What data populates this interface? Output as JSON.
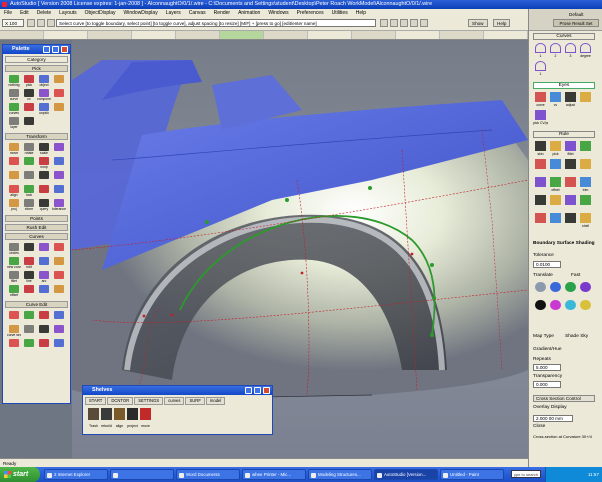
{
  "window": {
    "title": "AutoStudio [ Version 2008 License expires: 1-jan-2008 ] - AlconnaughtO/0/1/.wire - C:\\Documents and Settings\\student\\Desktop\\Peter Roach WorkModel\\AlconnaughtO/0/1/.wire"
  },
  "menu": [
    "File",
    "Edit",
    "Delete",
    "Layouts",
    "ObjectDisplay",
    "WindowDisplay",
    "Layers",
    "Canvas",
    "Render",
    "Animation",
    "Windows",
    "Preferences",
    "Utilities",
    "Help"
  ],
  "toolbar": {
    "zoom": "X 100",
    "hint": "Select curve [to toggle boundary, select point] [to toggle curve], adjust spacing [to resize] [M/F] + [press to go] [edit/enter name]",
    "btn_a": "Show",
    "btn_b": "Help"
  },
  "section_bar": [
    "",
    "",
    "",
    "",
    "",
    "",
    "",
    "",
    "",
    "",
    "",
    ""
  ],
  "palette": {
    "title": "Palette",
    "category": "Category",
    "sections": [
      {
        "label": "Pick",
        "items": [
          "nothing",
          "pick",
          "object",
          "",
          "curve",
          "cv",
          "component",
          "",
          "curves",
          "",
          "unpick",
          "",
          "layer",
          ""
        ]
      },
      {
        "label": "Transform",
        "items": [
          "move",
          "rotate",
          "scale",
          "",
          "",
          "",
          "nonp",
          "",
          "",
          "",
          "",
          "",
          "align",
          "lock",
          "",
          "",
          "proj",
          "xform",
          "query",
          "tolerance"
        ]
      },
      {
        "label": "Points",
        "items": []
      },
      {
        "label": "Rush Edit",
        "items": []
      },
      {
        "label": "Curves",
        "items": [
          "circles",
          "",
          "",
          "",
          "new curve",
          "edit",
          "",
          "",
          "fillet",
          "line",
          "arc",
          "",
          "offset",
          "",
          "",
          ""
        ]
      },
      {
        "label": "Curve Edit",
        "items": [
          "",
          "",
          "",
          "",
          "curve section",
          "",
          "",
          "",
          "",
          "",
          "",
          ""
        ]
      }
    ]
  },
  "right_panel": {
    "default": "Default",
    "preview": "Prose Result Set",
    "sections": [
      {
        "label": "Curves",
        "items": [
          "1",
          "2",
          "3",
          "degree",
          "1"
        ]
      },
      {
        "label": "Eyes",
        "items": [
          "curve",
          "cv",
          "adjust",
          "",
          "pick CV/pnt"
        ]
      },
      {
        "label": "Rule",
        "items": [
          "skin",
          "pick",
          "fillet",
          "",
          "",
          "",
          "",
          "",
          "",
          "offset",
          "",
          "trim",
          "",
          "",
          "",
          "",
          "",
          "",
          "",
          "shell"
        ]
      }
    ],
    "props_title": "Boundary Surface Shading",
    "tolerance_label": "Tolerance",
    "tolerance_value": "0.0100",
    "translate_label": "Translate",
    "fast_label": "Fast",
    "map_type_label": "Map Type",
    "shade_label": "Shade Sky",
    "gradient_label": "Gradient/Hue",
    "repeats_label": "Repeats",
    "repeats_value": "5.000",
    "transparency_label": "Transparency",
    "transparency_value": "0.000",
    "cross_label": "Cross Section Control",
    "overlay_label": "Overlay Display",
    "mode_value": "2.000 00 mm",
    "close_label": "Close",
    "bottom_label": "Cross-section at Curvature 30+/4"
  },
  "shelves": {
    "title": "Shelves",
    "tabs": [
      "START",
      "DCNTOR",
      "SETTINGS",
      "curves",
      "SURF",
      "model"
    ],
    "tools": [
      "Trash",
      "rebuild",
      "align",
      "project",
      "move"
    ]
  },
  "status": "Ready",
  "taskbar": {
    "start": "start",
    "tasks": [
      "2 Internet Explorer",
      "",
      "Word Documents",
      "whee Printer - Mic...",
      "Modeling Structures...",
      "AutoStudio [Version...",
      "Untitled - Paint"
    ],
    "search": "ype to search",
    "clock": "11:57"
  },
  "colors": {
    "surface_blue": "#5c6fe0",
    "curve_green": "#2c9a2c",
    "cv_red": "#c2202a",
    "titlebar": "#0b3fb8"
  }
}
